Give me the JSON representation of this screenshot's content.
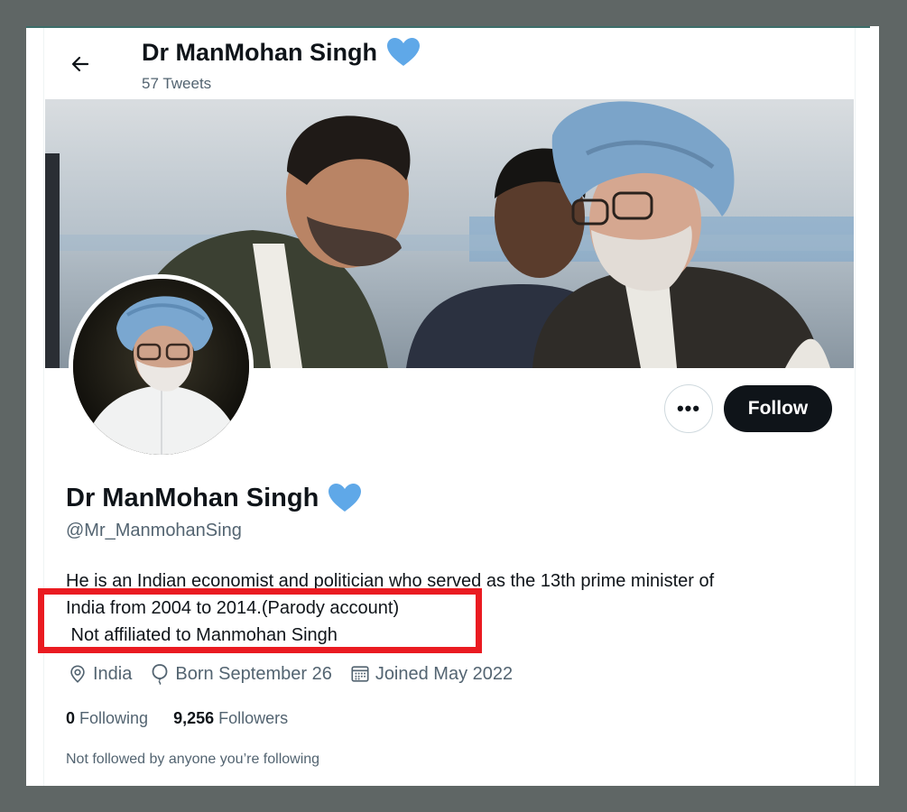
{
  "header": {
    "name": "Dr ManMohan Singh",
    "tweet_count": "57 Tweets"
  },
  "profile": {
    "name": "Dr ManMohan Singh",
    "handle": "@Mr_ManmohanSing",
    "bio_lines": [
      "He is an Indian economist and politician who served as the 13th prime minister of",
      "India from 2004 to 2014.(Parody account)",
      " Not affiliated to Manmohan Singh"
    ],
    "location": "India",
    "birthday": "Born September 26",
    "joined": "Joined May 2022",
    "following_count": "0",
    "following_label": "Following",
    "followers_count": "9,256",
    "followers_label": "Followers",
    "not_followed_text": "Not followed by anyone you’re following"
  },
  "actions": {
    "more_label": "•••",
    "follow_label": "Follow"
  },
  "icons": {
    "back": "arrow-left-icon",
    "verified": "blue-heart-icon",
    "location": "location-pin-icon",
    "birthday": "balloon-icon",
    "joined": "calendar-icon",
    "more": "more-options-icon"
  },
  "colors": {
    "verified_heart": "#5fa8e8",
    "highlight_box": "#ea1b21",
    "follow_button": "#0f1419",
    "secondary_text": "#536471"
  }
}
